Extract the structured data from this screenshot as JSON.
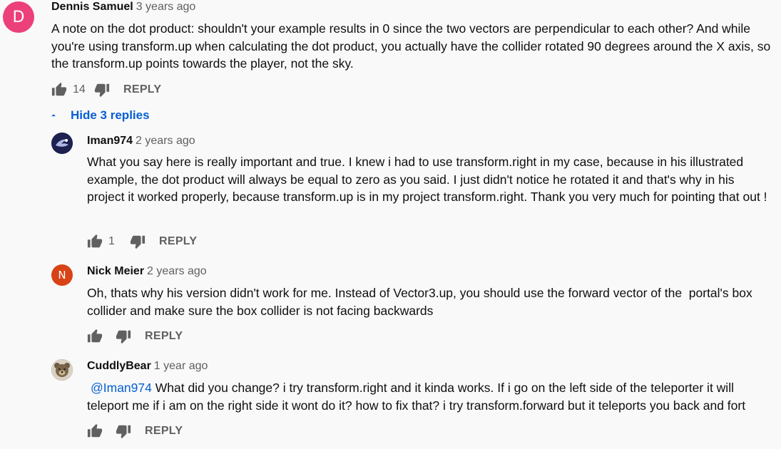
{
  "comments": [
    {
      "author": "Dennis Samuel",
      "time": "3 years ago",
      "avatar_letter": "D",
      "avatar_color": "#ec407a",
      "text": "A note on the dot product: shouldn't your example results in 0 since the two vectors are perpendicular to each other? And while you're using transform.up when calculating the dot product, you actually have the collider rotated 90 degrees around the X axis, so the transform.up points towards the player, not the sky.",
      "likes": "14",
      "reply_label": "REPLY"
    }
  ],
  "hide_replies_label": "Hide 3 replies",
  "replies": [
    {
      "author": "Iman974",
      "time": "2 years ago",
      "avatar_color": "#1c2150",
      "text": "What you say here is really important and true. I knew i had to use transform.right in my case, because in his illustrated example, the dot product will always be equal to zero as you said. I just didn't notice he rotated it and that's why in his project it worked properly, because transform.up is in my project transform.right. Thank you very much for pointing that out !",
      "likes": "1",
      "reply_label": "REPLY"
    },
    {
      "author": "Nick Meier",
      "time": "2 years ago",
      "avatar_letter": "N",
      "avatar_color": "#d84315",
      "text": "Oh, thats why his version didn't work for me. Instead of Vector3.up, you should use the forward vector of the  portal's box collider and make sure the box collider is not facing backwards",
      "likes": "",
      "reply_label": "REPLY"
    },
    {
      "author": "CuddlyBear",
      "time": "1 year ago",
      "avatar_color": "#6d5a42",
      "mention": "@Iman974",
      "text": " What did you change? i try transform.right and it kinda works. If i go on the left side of the teleporter it will teleport me if i am on the right side it wont do it? how to fix that? i try transform.forward but it teleports you back and fort",
      "likes": "",
      "reply_label": "REPLY"
    }
  ],
  "icons": {
    "like": "thumbs-up-icon",
    "dislike": "thumbs-down-icon",
    "collapse": "caret-up-icon"
  },
  "colors": {
    "background": "#f9f9f9",
    "text": "#0f0f0f",
    "secondary": "#606060",
    "link": "#065fd4"
  }
}
